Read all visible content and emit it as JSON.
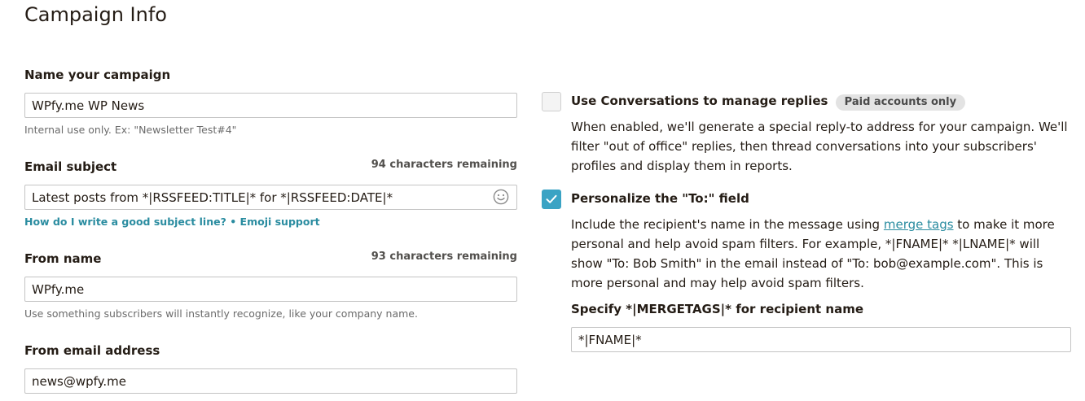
{
  "page": {
    "title": "Campaign Info"
  },
  "campaign_name": {
    "label": "Name your campaign",
    "value": "WPfy.me WP News",
    "help": "Internal use only. Ex: \"Newsletter Test#4\""
  },
  "email_subject": {
    "label": "Email subject",
    "count": "94 characters remaining",
    "value": "Latest posts from *|RSSFEED:TITLE|* for *|RSSFEED:DATE|*",
    "help_link": "How do I write a good subject line?",
    "separator": " • ",
    "emoji_link": "Emoji support"
  },
  "from_name": {
    "label": "From name",
    "count": "93 characters remaining",
    "value": "WPfy.me",
    "help": "Use something subscribers will instantly recognize, like your company name."
  },
  "from_email": {
    "label": "From email address",
    "value": "news@wpfy.me"
  },
  "conversations": {
    "checked": false,
    "label": "Use Conversations to manage replies",
    "badge": "Paid accounts only",
    "description": "When enabled, we'll generate a special reply-to address for your campaign. We'll filter \"out of office\" replies, then thread conversations into your subscribers' profiles and display them in reports."
  },
  "personalize": {
    "checked": true,
    "label": "Personalize the \"To:\" field",
    "desc_before": "Include the recipient's name in the message using ",
    "desc_link": "merge tags",
    "desc_after": " to make it more personal and help avoid spam filters. For example, *|FNAME|* *|LNAME|* will show \"To: Bob Smith\" in the email instead of \"To: bob@example.com\". This is more personal and may help avoid spam filters.",
    "mergetag_label": "Specify *|MERGETAGS|* for recipient name",
    "mergetag_value": "*|FNAME|*"
  },
  "icons": {
    "emoji": "smiley-face-icon",
    "check": "checkmark-icon"
  },
  "colors": {
    "accent": "#3aa3c4",
    "link": "#2a8ca0",
    "text": "#241c15"
  }
}
